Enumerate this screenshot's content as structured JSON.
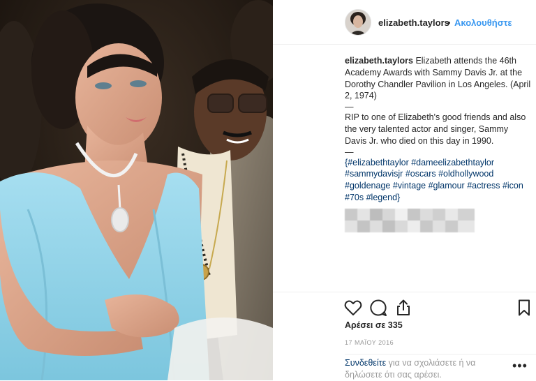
{
  "post": {
    "username": "elizabeth.taylors",
    "follow_separator": "•",
    "follow_label": "Ακολουθήστε",
    "photo_description_icon": "post-photo",
    "caption": {
      "username": "elizabeth.taylors",
      "text1": "Elizabeth attends the 46th Academy Awards with Sammy Davis Jr. at the Dorothy Chandler Pavilion in Los Angeles. (April 2, 1974)",
      "dash1": "—",
      "text2": "RIP to one of Elizabeth's good friends and also the very talented actor and singer, Sammy Davis Jr. who died on this day in 1990.",
      "dash2": "—",
      "hashtags": [
        "{#elizabethtaylor",
        "#dameelizabethtaylor",
        "#sammydavisjr",
        "#oscars",
        "#oldhollywood",
        "#goldenage",
        "#vintage",
        "#glamour",
        "#actress",
        "#icon",
        "#70s",
        "#legend}"
      ]
    },
    "likes_label": "Αρέσει σε 335",
    "date": "17 ΜΑΪΟΥ 2016",
    "login_link": "Συνδεθείτε",
    "login_text": " για να σχολιάσετε ή να δηλώσετε ότι σας αρέσει.",
    "more_label": "•••",
    "icons": [
      "heart-icon",
      "comment-icon",
      "share-icon",
      "bookmark-icon"
    ]
  },
  "colors": {
    "link": "#3897f0",
    "hashtag": "#003569",
    "text": "#262626",
    "muted": "#999999",
    "dress": "#8fd3e8"
  }
}
